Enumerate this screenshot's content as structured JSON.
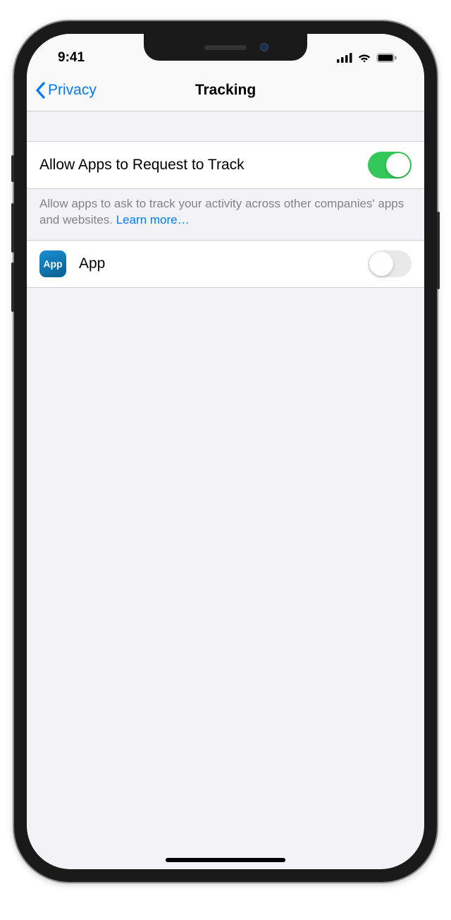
{
  "status": {
    "time": "9:41"
  },
  "nav": {
    "back_label": "Privacy",
    "title": "Tracking"
  },
  "master_toggle": {
    "label": "Allow Apps to Request to Track",
    "on": true
  },
  "footer": {
    "text": "Allow apps to ask to track your activity across other companies' apps and websites. ",
    "link": "Learn more…"
  },
  "apps": [
    {
      "icon_label": "App",
      "name": "App",
      "on": false
    }
  ]
}
